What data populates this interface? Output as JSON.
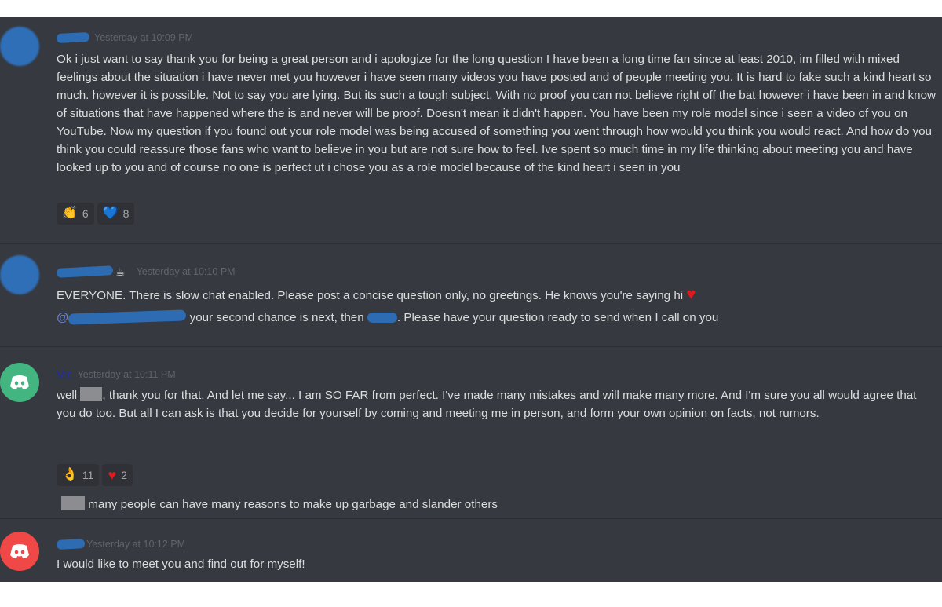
{
  "colors": {
    "chat_background": "#36393f",
    "reaction_background": "#2f3136",
    "text": "#dcddde",
    "timestamp": "#61646b",
    "redaction_blue": "#2d6cb3",
    "discord_green": "#43b581",
    "discord_red": "#f04747",
    "mention": "#7289da",
    "vic_name": "#1d2ea8"
  },
  "messages": [
    {
      "avatar": "blurred-avatar",
      "timestamp": "Yesterday at 10:09 PM",
      "lines": [
        "Ok i just want to say thank you for being a great person and i apologize for the long question I have been a long time fan since at least 2010, im filled with mixed feelings about the situation i have never met you however i have seen many videos you have posted and of people meeting you. It is hard to fake such a kind heart so much. however it is possible. Not to say you are lying. But its such a tough subject. With no proof you can not believe right off the bat however i have been in and know of situations that have happened where the is and never will be proof. Doesn't mean it didn't happen. You have been my role model since i seen a video of you on YouTube. Now my question if you found out your role model was being accused of something you went through how would you think you would react. And how do you think you could reassure those fans who want to believe in you but are not sure how to feel. Ive spent so much time in my life thinking about meeting you and have looked up to you and of course no one is perfect  ut i chose you as a role model because of the kind heart i seen in you"
      ],
      "reactions": [
        {
          "icon": "clap-icon",
          "emoji": "👏",
          "count": "6"
        },
        {
          "icon": "blue-heart-icon",
          "emoji": "💙",
          "count": "8"
        }
      ]
    },
    {
      "avatar": "blurred-avatar",
      "name_suffix_emoji": "☕",
      "timestamp": "Yesterday at 10:10 PM",
      "line1": "EVERYONE. There is slow chat enabled. Please post a concise question only, no greetings. He knows you're saying hi",
      "line1_heart": "♥",
      "mention_at": "@",
      "line2_mid": " your second chance is next, then ",
      "line2_end": ". Please have your question ready to send when I call on you"
    },
    {
      "avatar": "discord-green-avatar",
      "name": "Vic",
      "timestamp": "Yesterday at 10:11 PM",
      "text_start": "well",
      "text_rest": ", thank you for that. And let me say... I am SO FAR from perfect. I've made many mistakes and will make many more. And I'm sure you all would agree that you do too. But all I can ask is that you decide for yourself by coming and meeting me in person, and form your own opinion on facts, not rumors.",
      "reactions": [
        {
          "icon": "ok-hand-icon",
          "emoji": "👌",
          "count": "11"
        },
        {
          "icon": "red-heart-icon",
          "emoji": "♥",
          "count": "2"
        }
      ],
      "followup": "many people can have many reasons to make up garbage and slander others"
    },
    {
      "avatar": "discord-red-avatar",
      "timestamp": "Yesterday at 10:12 PM",
      "text": "I would like to meet you and find out for myself!"
    }
  ]
}
